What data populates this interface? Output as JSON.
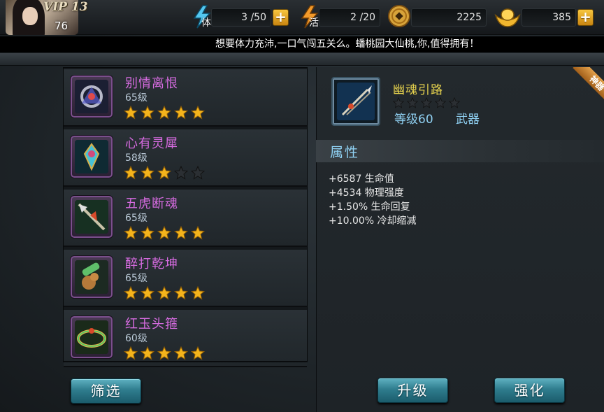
{
  "header": {
    "vip": "VIP 13",
    "player_level": "76",
    "stamina": {
      "tag": "体",
      "value": "3 /50"
    },
    "activity": {
      "tag": "活",
      "value": "2 /20"
    },
    "coins": {
      "value": "2225"
    },
    "gold": {
      "value": "385"
    },
    "plus_label": "+"
  },
  "ticker": {
    "text": "想要体力充沛,一口气闯五关么。蟠桃园大仙桃,你,值得拥有！"
  },
  "items": [
    {
      "name": "别情离恨",
      "level": "65级",
      "stars": 5
    },
    {
      "name": "心有灵犀",
      "level": "58级",
      "stars": 3
    },
    {
      "name": "五虎断魂",
      "level": "65级",
      "stars": 5
    },
    {
      "name": "醉打乾坤",
      "level": "65级",
      "stars": 5
    },
    {
      "name": "红玉头箍",
      "level": "60级",
      "stars": 5
    }
  ],
  "detail": {
    "name": "幽魂引路",
    "stars": 0,
    "level": "等级60",
    "type": "武器",
    "ribbon": "神器",
    "attr_header": "属性",
    "attrs": [
      "+6587 生命值",
      "+4534 物理强度",
      "+1.50% 生命回复",
      "+10.00% 冷却缩减"
    ]
  },
  "buttons": {
    "filter": "筛选",
    "upgrade": "升级",
    "enhance": "强化"
  },
  "colors": {
    "item_name": "#d66be0",
    "detail_name": "#e8d44e",
    "accent_blue": "#8fd0f2",
    "star_on": "#f4b41c",
    "star_off": "#2b2f33"
  }
}
